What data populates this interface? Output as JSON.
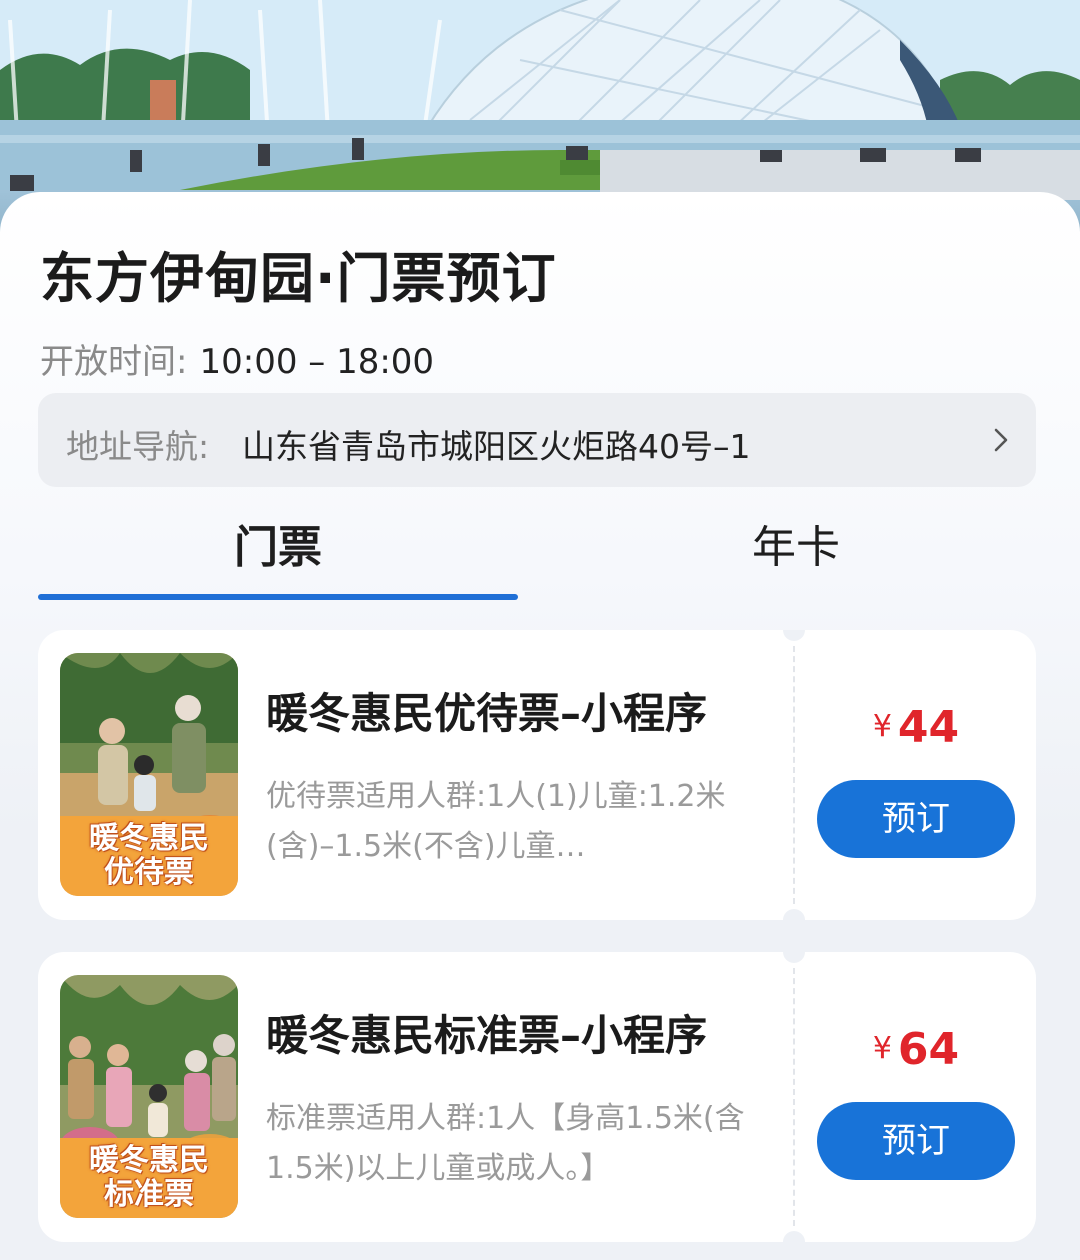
{
  "page": {
    "title": "东方伊甸园·门票预订",
    "hours_label": "开放时间:",
    "hours_value": "10:00 – 18:00",
    "address_label": "地址导航:",
    "address_value": "山东省青岛市城阳区火炬路40号–1"
  },
  "tabs": [
    {
      "label": "门票",
      "active": true
    },
    {
      "label": "年卡",
      "active": false
    }
  ],
  "tickets": [
    {
      "name": "暖冬惠民优待票–小程序",
      "description": "优待票适用人群:1人(1)儿童:1.2米(含)–1.5米(不含)儿童…",
      "thumb_line1": "暖冬惠民",
      "thumb_line2": "优待票",
      "currency": "¥",
      "price": "44",
      "button_label": "预订"
    },
    {
      "name": "暖冬惠民标准票–小程序",
      "description": "标准票适用人群:1人【身高1.5米(含1.5米)以上儿童或成人。】",
      "thumb_line1": "暖冬惠民",
      "thumb_line2": "标准票",
      "currency": "¥",
      "price": "64",
      "button_label": "预订"
    }
  ],
  "colors": {
    "accent": "#1f6fd6",
    "button": "#1873d8",
    "price": "#e0252b",
    "badge": "#f3a43b"
  },
  "icons": {
    "address_arrow": "chevron-right-icon"
  }
}
